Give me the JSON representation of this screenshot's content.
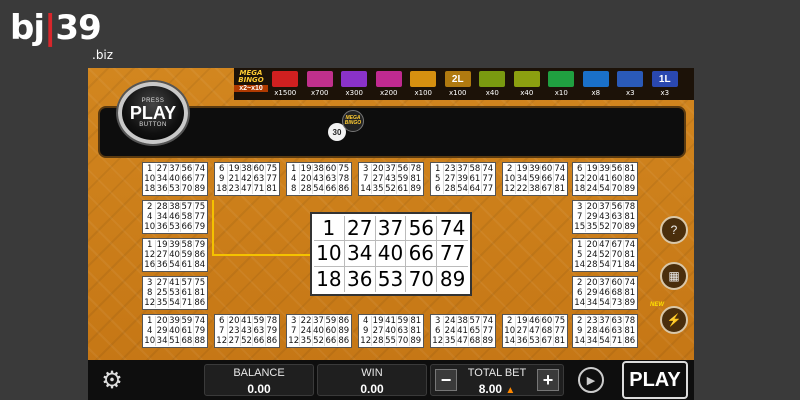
{
  "brand": {
    "bj": "bj",
    "bar": "|",
    "num": "39",
    "suffix": ".biz"
  },
  "paytable": {
    "mega": {
      "label": "MEGA BINGO",
      "mult": "x2~x10",
      "top_mult": "x1500"
    },
    "items": [
      {
        "mult": "x700",
        "color": "#c0308c"
      },
      {
        "mult": "x300",
        "color": "#8a32c8"
      },
      {
        "mult": "x200",
        "color": "#c02a90"
      },
      {
        "mult": "x100",
        "color": "#d69010"
      },
      {
        "mult": "x100",
        "color": "#b07a10",
        "text": "2L"
      },
      {
        "mult": "x40",
        "color": "#7a9a10"
      },
      {
        "mult": "x40",
        "color": "#8ca010"
      },
      {
        "mult": "x10",
        "color": "#20a040"
      },
      {
        "mult": "x8",
        "color": "#1a70c8"
      },
      {
        "mult": "x3",
        "color": "#2a5ab8"
      },
      {
        "mult": "x3",
        "color": "#2a48b0",
        "text": "1L"
      }
    ]
  },
  "track": {
    "ball": "30",
    "mega_label": "MEGA BINGO"
  },
  "press_play": {
    "top": "PRESS",
    "main": "PLAY",
    "bottom": "BUTTON"
  },
  "featured_card": [
    "1",
    "27",
    "37",
    "56",
    "74",
    "10",
    "34",
    "40",
    "66",
    "77",
    "18",
    "36",
    "53",
    "70",
    "89"
  ],
  "cards": [
    {
      "n": [
        "1",
        "27",
        "37",
        "56",
        "74",
        "10",
        "34",
        "40",
        "66",
        "77",
        "18",
        "36",
        "53",
        "70",
        "89"
      ]
    },
    {
      "n": [
        "6",
        "19",
        "38",
        "60",
        "75",
        "9",
        "21",
        "42",
        "63",
        "77",
        "18",
        "23",
        "47",
        "71",
        "81"
      ]
    },
    {
      "n": [
        "1",
        "19",
        "38",
        "60",
        "75",
        "4",
        "20",
        "43",
        "63",
        "78",
        "8",
        "28",
        "54",
        "66",
        "86"
      ]
    },
    {
      "n": [
        "3",
        "20",
        "37",
        "56",
        "78",
        "7",
        "27",
        "43",
        "59",
        "81",
        "14",
        "35",
        "52",
        "61",
        "89"
      ]
    },
    {
      "n": [
        "1",
        "23",
        "37",
        "58",
        "74",
        "5",
        "27",
        "39",
        "61",
        "77",
        "6",
        "28",
        "54",
        "64",
        "77"
      ]
    },
    {
      "n": [
        "2",
        "19",
        "39",
        "60",
        "74",
        "10",
        "34",
        "59",
        "66",
        "74",
        "12",
        "22",
        "38",
        "67",
        "81"
      ]
    },
    {
      "n": [
        "6",
        "19",
        "39",
        "56",
        "81",
        "12",
        "20",
        "41",
        "60",
        "80",
        "18",
        "24",
        "54",
        "70",
        "89"
      ]
    },
    {
      "n": [
        "2",
        "28",
        "38",
        "57",
        "75",
        "4",
        "34",
        "46",
        "58",
        "77",
        "10",
        "36",
        "53",
        "66",
        "79"
      ]
    },
    {
      "n": [
        "3",
        "20",
        "37",
        "56",
        "78",
        "7",
        "29",
        "43",
        "63",
        "81",
        "15",
        "35",
        "52",
        "70",
        "89"
      ]
    },
    {
      "n": [
        "1",
        "19",
        "39",
        "58",
        "79",
        "12",
        "27",
        "40",
        "59",
        "86",
        "16",
        "36",
        "54",
        "61",
        "84"
      ]
    },
    {
      "n": [
        "1",
        "20",
        "47",
        "67",
        "74",
        "5",
        "24",
        "52",
        "70",
        "81",
        "14",
        "28",
        "54",
        "71",
        "84"
      ]
    },
    {
      "n": [
        "3",
        "27",
        "41",
        "57",
        "75",
        "8",
        "25",
        "53",
        "61",
        "81",
        "12",
        "35",
        "54",
        "71",
        "86"
      ]
    },
    {
      "n": [
        "2",
        "20",
        "37",
        "60",
        "74",
        "6",
        "29",
        "46",
        "68",
        "81",
        "14",
        "34",
        "54",
        "73",
        "89"
      ]
    },
    {
      "n": [
        "1",
        "20",
        "39",
        "59",
        "74",
        "4",
        "29",
        "40",
        "61",
        "79",
        "10",
        "34",
        "51",
        "68",
        "88"
      ]
    },
    {
      "n": [
        "6",
        "20",
        "41",
        "59",
        "78",
        "7",
        "23",
        "43",
        "63",
        "79",
        "12",
        "27",
        "52",
        "66",
        "86"
      ]
    },
    {
      "n": [
        "3",
        "22",
        "37",
        "59",
        "86",
        "7",
        "24",
        "40",
        "60",
        "89",
        "12",
        "35",
        "52",
        "66",
        "86"
      ]
    },
    {
      "n": [
        "4",
        "19",
        "41",
        "59",
        "81",
        "9",
        "27",
        "40",
        "63",
        "81",
        "12",
        "28",
        "55",
        "70",
        "89"
      ]
    },
    {
      "n": [
        "3",
        "24",
        "38",
        "57",
        "74",
        "6",
        "24",
        "41",
        "65",
        "77",
        "12",
        "35",
        "47",
        "68",
        "89"
      ]
    },
    {
      "n": [
        "2",
        "19",
        "46",
        "60",
        "75",
        "10",
        "27",
        "47",
        "68",
        "77",
        "14",
        "36",
        "53",
        "67",
        "81"
      ]
    },
    {
      "n": [
        "2",
        "23",
        "37",
        "63",
        "78",
        "9",
        "28",
        "46",
        "63",
        "81",
        "14",
        "34",
        "54",
        "71",
        "86"
      ]
    }
  ],
  "side": {
    "help": "?",
    "cards": "▦",
    "turbo": "⚡",
    "new": "NEW"
  },
  "bottom": {
    "balance_label": "BALANCE",
    "balance": "0.00",
    "win_label": "WIN",
    "win": "0.00",
    "bet_label": "TOTAL BET",
    "bet": "8.00",
    "minus": "−",
    "plus": "+",
    "arrow": "▲",
    "play": "PLAY"
  }
}
